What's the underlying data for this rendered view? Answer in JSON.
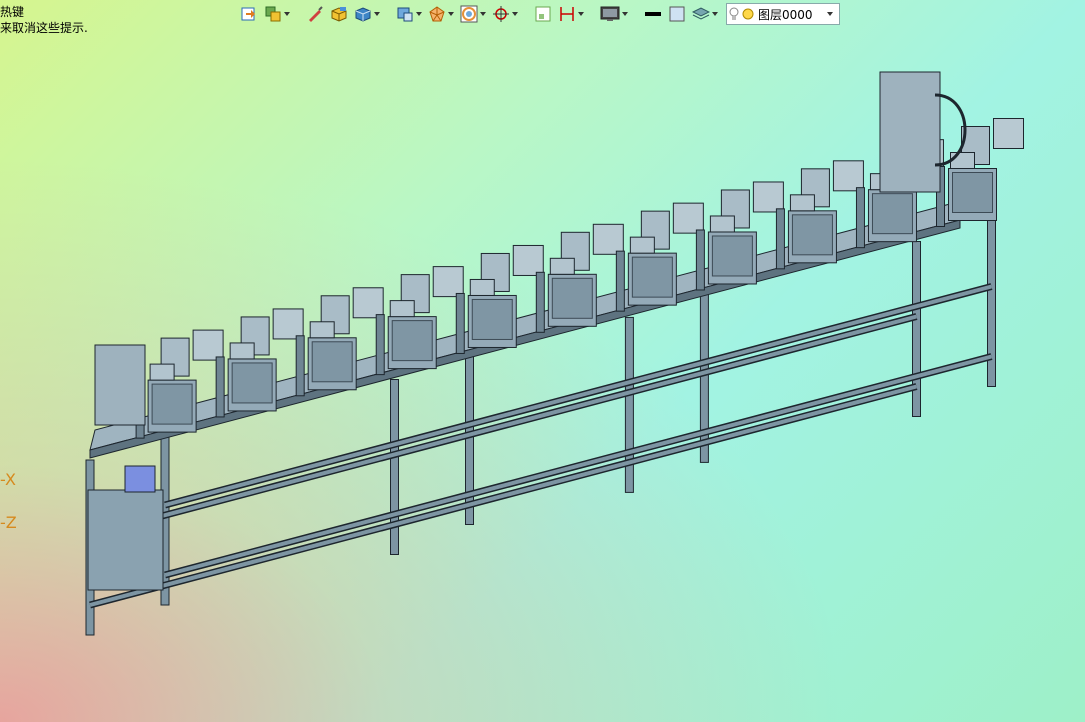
{
  "hint": {
    "line1": "热键",
    "line2": "来取消这些提示."
  },
  "toolbar": {
    "icons": [
      "view-orient-icon",
      "display-style-icon",
      "section-icon",
      "box-shade-icon",
      "cube-view-icon",
      "view-cube-icon",
      "render-icon",
      "target-icon",
      "triad-icon",
      "frame-icon",
      "dimension-icon",
      "monitor-icon",
      "line-color-swatch",
      "fill-color-swatch",
      "layer-stack-icon"
    ],
    "layer": {
      "value": "图层0000",
      "icons": [
        "lightbulb-icon",
        "sun-icon"
      ]
    }
  },
  "axis": {
    "x_label": "X",
    "z_label": "Z"
  },
  "colors": {
    "metal": "#7d95a3",
    "metal_dark": "#3c4a55",
    "edge": "#1d262e"
  }
}
